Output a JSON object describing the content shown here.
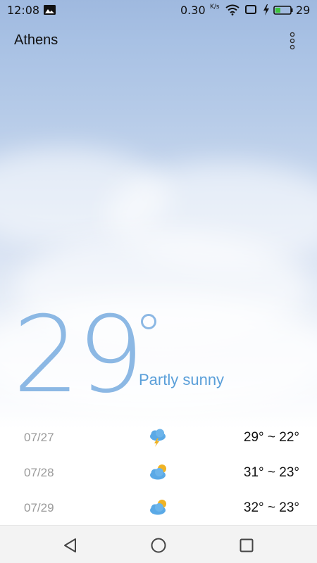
{
  "status_bar": {
    "time": "12:08",
    "network_speed": "0.30",
    "network_speed_unit": "K/s",
    "battery_level": "29",
    "icons": [
      "image-notification-icon",
      "wifi-icon",
      "screen-cast-icon",
      "charging-icon",
      "battery-icon"
    ]
  },
  "header": {
    "city": "Athens",
    "menu_icon": "more-vertical-icon"
  },
  "current": {
    "temperature": "29",
    "condition": "Partly sunny"
  },
  "forecast": [
    {
      "date": "07/27",
      "icon": "thunderstorm-icon",
      "range": "29° ~ 22°"
    },
    {
      "date": "07/28",
      "icon": "partly-sunny-icon",
      "range": "31° ~ 23°"
    },
    {
      "date": "07/29",
      "icon": "partly-sunny-icon",
      "range": "32° ~ 23°"
    }
  ],
  "nav_bar": {
    "icons": [
      "back-icon",
      "home-icon",
      "recents-icon"
    ]
  },
  "colors": {
    "temperature": "#8cb8e4",
    "condition": "#5a9fd9",
    "battery_fill": "#3cc43c"
  }
}
